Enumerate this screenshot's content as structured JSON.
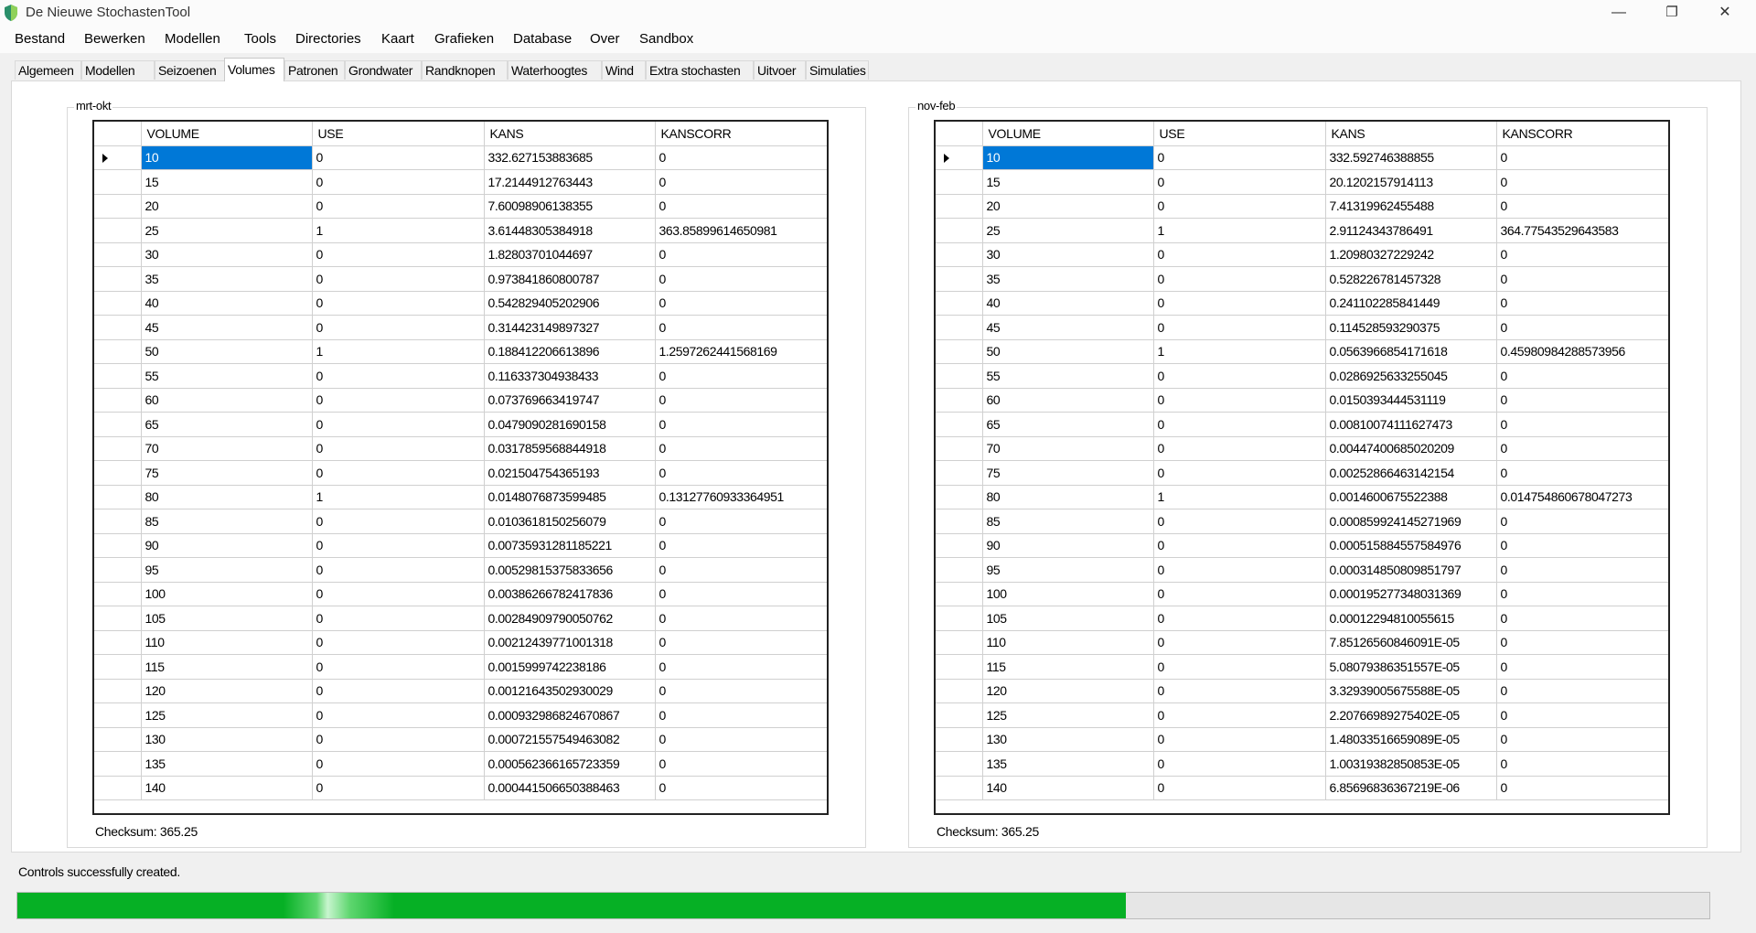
{
  "window": {
    "title": "De Nieuwe StochastenTool",
    "minimize": "—",
    "restore": "❐",
    "close": "✕"
  },
  "menu": [
    "Bestand",
    "Bewerken",
    "Modellen",
    "Tools",
    "Directories",
    "Kaart",
    "Grafieken",
    "Database",
    "Over",
    "Sandbox"
  ],
  "tabs": [
    "Algemeen",
    "Modellen",
    "Seizoenen",
    "Volumes",
    "Patronen",
    "Grondwater",
    "Randknopen",
    "Waterhoogtes",
    "Wind",
    "Extra stochasten",
    "Uitvoer",
    "Simulaties"
  ],
  "active_tab": "Volumes",
  "columns": [
    "VOLUME",
    "USE",
    "KANS",
    "KANSCORR"
  ],
  "panels": [
    {
      "label": "mrt-okt",
      "checksum": "Checksum: 365.25",
      "rows": [
        [
          "10",
          "0",
          "332.627153883685",
          "0"
        ],
        [
          "15",
          "0",
          "17.2144912763443",
          "0"
        ],
        [
          "20",
          "0",
          "7.60098906138355",
          "0"
        ],
        [
          "25",
          "1",
          "3.61448305384918",
          "363.85899614650981"
        ],
        [
          "30",
          "0",
          "1.82803701044697",
          "0"
        ],
        [
          "35",
          "0",
          "0.973841860800787",
          "0"
        ],
        [
          "40",
          "0",
          "0.542829405202906",
          "0"
        ],
        [
          "45",
          "0",
          "0.314423149897327",
          "0"
        ],
        [
          "50",
          "1",
          "0.188412206613896",
          "1.2597262441568169"
        ],
        [
          "55",
          "0",
          "0.116337304938433",
          "0"
        ],
        [
          "60",
          "0",
          "0.073769663419747",
          "0"
        ],
        [
          "65",
          "0",
          "0.0479090281690158",
          "0"
        ],
        [
          "70",
          "0",
          "0.0317859568844918",
          "0"
        ],
        [
          "75",
          "0",
          "0.021504754365193",
          "0"
        ],
        [
          "80",
          "1",
          "0.0148076873599485",
          "0.13127760933364951"
        ],
        [
          "85",
          "0",
          "0.0103618150256079",
          "0"
        ],
        [
          "90",
          "0",
          "0.00735931281185221",
          "0"
        ],
        [
          "95",
          "0",
          "0.00529815375833656",
          "0"
        ],
        [
          "100",
          "0",
          "0.00386266782417836",
          "0"
        ],
        [
          "105",
          "0",
          "0.00284909790050762",
          "0"
        ],
        [
          "110",
          "0",
          "0.00212439771001318",
          "0"
        ],
        [
          "115",
          "0",
          "0.0015999742238186",
          "0"
        ],
        [
          "120",
          "0",
          "0.00121643502930029",
          "0"
        ],
        [
          "125",
          "0",
          "0.000932986824670867",
          "0"
        ],
        [
          "130",
          "0",
          "0.000721557549463082",
          "0"
        ],
        [
          "135",
          "0",
          "0.000562366165723359",
          "0"
        ],
        [
          "140",
          "0",
          "0.000441506650388463",
          "0"
        ]
      ]
    },
    {
      "label": "nov-feb",
      "checksum": "Checksum: 365.25",
      "rows": [
        [
          "10",
          "0",
          "332.592746388855",
          "0"
        ],
        [
          "15",
          "0",
          "20.1202157914113",
          "0"
        ],
        [
          "20",
          "0",
          "7.41319962455488",
          "0"
        ],
        [
          "25",
          "1",
          "2.91124343786491",
          "364.77543529643583"
        ],
        [
          "30",
          "0",
          "1.20980327229242",
          "0"
        ],
        [
          "35",
          "0",
          "0.528226781457328",
          "0"
        ],
        [
          "40",
          "0",
          "0.241102285841449",
          "0"
        ],
        [
          "45",
          "0",
          "0.114528593290375",
          "0"
        ],
        [
          "50",
          "1",
          "0.0563966854171618",
          "0.45980984288573956"
        ],
        [
          "55",
          "0",
          "0.0286925633255045",
          "0"
        ],
        [
          "60",
          "0",
          "0.0150393444531119",
          "0"
        ],
        [
          "65",
          "0",
          "0.00810074111627473",
          "0"
        ],
        [
          "70",
          "0",
          "0.00447400685020209",
          "0"
        ],
        [
          "75",
          "0",
          "0.00252866463142154",
          "0"
        ],
        [
          "80",
          "1",
          "0.0014600675522388",
          "0.014754860678047273"
        ],
        [
          "85",
          "0",
          "0.000859924145271969",
          "0"
        ],
        [
          "90",
          "0",
          "0.000515884557584976",
          "0"
        ],
        [
          "95",
          "0",
          "0.000314850809851797",
          "0"
        ],
        [
          "100",
          "0",
          "0.000195277348031369",
          "0"
        ],
        [
          "105",
          "0",
          "0.00012294810055615",
          "0"
        ],
        [
          "110",
          "0",
          "7.85126560846091E-05",
          "0"
        ],
        [
          "115",
          "0",
          "5.08079386351557E-05",
          "0"
        ],
        [
          "120",
          "0",
          "3.32939005675588E-05",
          "0"
        ],
        [
          "125",
          "0",
          "2.20766989275402E-05",
          "0"
        ],
        [
          "130",
          "0",
          "1.48033516659089E-05",
          "0"
        ],
        [
          "135",
          "0",
          "1.00319382850853E-05",
          "0"
        ],
        [
          "140",
          "0",
          "6.85696836367219E-06",
          "0"
        ]
      ]
    }
  ],
  "status": "Controls successfully created.",
  "progress_percent": 65.5,
  "colors": {
    "selection": "#0078d7",
    "progress": "#06b025"
  }
}
